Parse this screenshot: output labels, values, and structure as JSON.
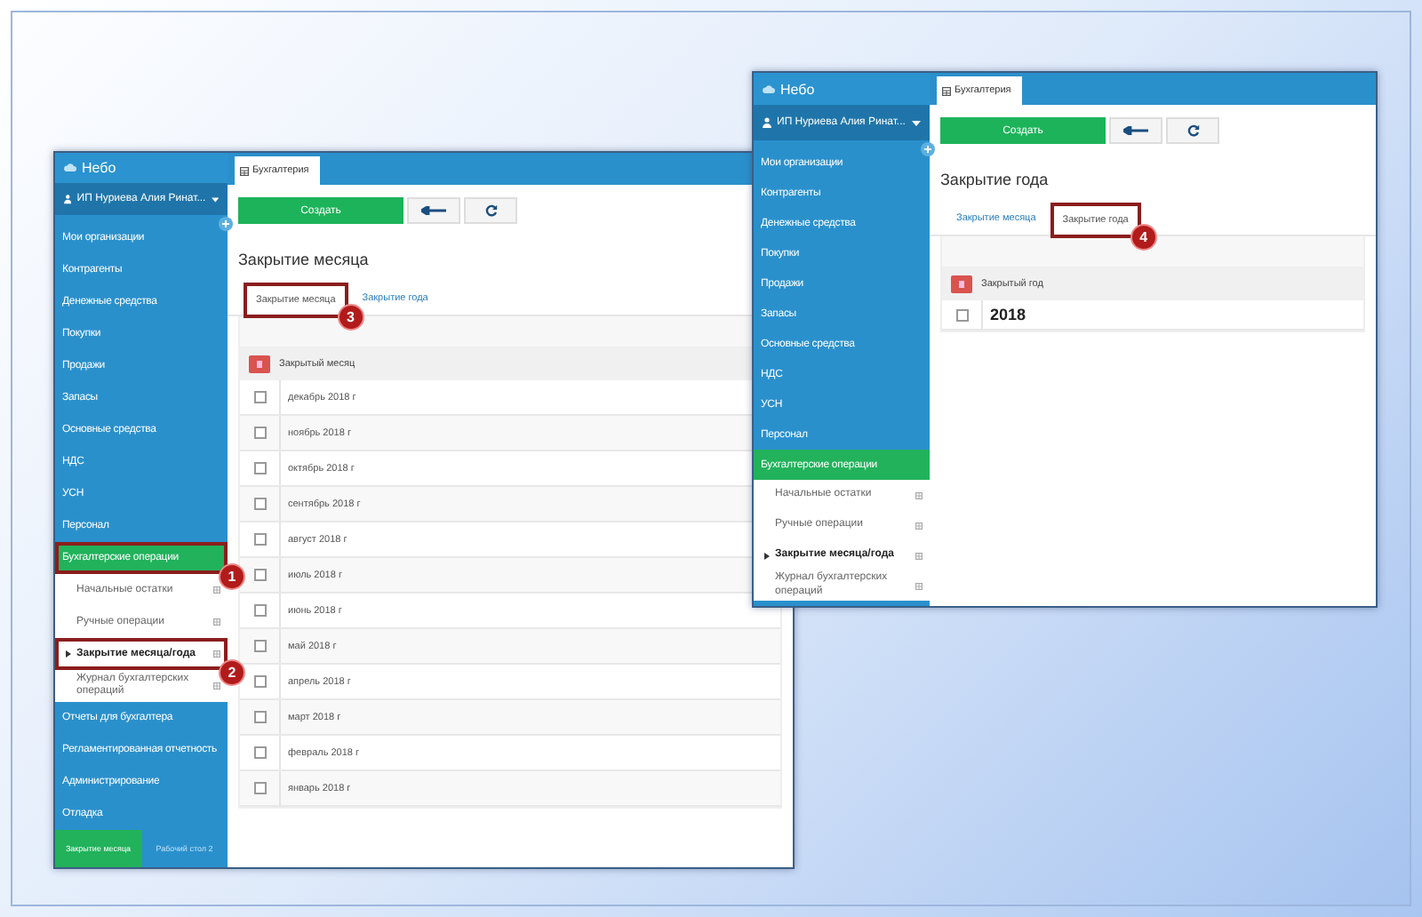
{
  "windows": [
    {
      "logo": "Небо",
      "user": "ИП Нуриева Алия Ринат...",
      "tab": "Бухгалтерия",
      "create_button": "Создать",
      "page_title": "Закрытие месяца",
      "nav": [
        {
          "label": "Мои организации",
          "selected": false
        },
        {
          "label": "Контрагенты",
          "selected": false
        },
        {
          "label": "Денежные средства",
          "selected": false
        },
        {
          "label": "Покупки",
          "selected": false
        },
        {
          "label": "Продажи",
          "selected": false
        },
        {
          "label": "Запасы",
          "selected": false
        },
        {
          "label": "Основные средства",
          "selected": false
        },
        {
          "label": "НДС",
          "selected": false
        },
        {
          "label": "УСН",
          "selected": false
        },
        {
          "label": "Персонал",
          "selected": false
        },
        {
          "label": "Бухгалтерские операции",
          "selected": true,
          "callout": "1",
          "children": [
            {
              "label": "Начальные остатки",
              "selected": false
            },
            {
              "label": "Ручные операции",
              "selected": false
            },
            {
              "label": "Закрытие месяца/года",
              "selected": true,
              "callout": "2"
            },
            {
              "label": "Журнал бухгалтерских операций",
              "selected": false
            }
          ]
        },
        {
          "label": "Отчеты для бухгалтера",
          "selected": false
        },
        {
          "label": "Регламентированная отчетность",
          "selected": false
        },
        {
          "label": "Администрирование",
          "selected": false
        },
        {
          "label": "Отладка",
          "selected": false
        }
      ],
      "bottom_tabs": [
        {
          "label": "Закрытие месяца",
          "selected": true
        },
        {
          "label": "Рабочий стол 2",
          "selected": false
        }
      ],
      "view_tabs": [
        {
          "label": "Закрытие месяца",
          "selected": true,
          "callout": "3"
        },
        {
          "label": "Закрытие года",
          "selected": false
        }
      ],
      "table": {
        "kind": "month",
        "column": "Закрытый месяц",
        "rows": [
          {
            "text": "декабрь 2018 г",
            "checked": false
          },
          {
            "text": "ноябрь 2018 г",
            "checked": false
          },
          {
            "text": "октябрь 2018 г",
            "checked": false
          },
          {
            "text": "сентябрь 2018 г",
            "checked": false
          },
          {
            "text": "август 2018 г",
            "checked": false
          },
          {
            "text": "июль 2018 г",
            "checked": false
          },
          {
            "text": "июнь 2018 г",
            "checked": false
          },
          {
            "text": "май 2018 г",
            "checked": false
          },
          {
            "text": "апрель 2018 г",
            "checked": false
          },
          {
            "text": "март 2018 г",
            "checked": false
          },
          {
            "text": "февраль 2018 г",
            "checked": false
          },
          {
            "text": "январь 2018 г",
            "checked": false
          }
        ]
      }
    },
    {
      "logo": "Небо",
      "user": "ИП Нуриева Алия Ринат...",
      "tab": "Бухгалтерия",
      "create_button": "Создать",
      "page_title": "Закрытие года",
      "nav": [
        {
          "label": "Мои организации",
          "selected": false
        },
        {
          "label": "Контрагенты",
          "selected": false
        },
        {
          "label": "Денежные средства",
          "selected": false
        },
        {
          "label": "Покупки",
          "selected": false
        },
        {
          "label": "Продажи",
          "selected": false
        },
        {
          "label": "Запасы",
          "selected": false
        },
        {
          "label": "Основные средства",
          "selected": false
        },
        {
          "label": "НДС",
          "selected": false
        },
        {
          "label": "УСН",
          "selected": false
        },
        {
          "label": "Персонал",
          "selected": false
        },
        {
          "label": "Бухгалтерские операции",
          "selected": true,
          "children": [
            {
              "label": "Начальные остатки",
              "selected": false
            },
            {
              "label": "Ручные операции",
              "selected": false
            },
            {
              "label": "Закрытие месяца/года",
              "selected": true
            },
            {
              "label": "Журнал бухгалтерских операций",
              "selected": false
            }
          ]
        }
      ],
      "view_tabs": [
        {
          "label": "Закрытие месяца",
          "selected": false
        },
        {
          "label": "Закрытие года",
          "selected": true,
          "callout": "4"
        }
      ],
      "table": {
        "kind": "year",
        "column": "Закрытый год",
        "rows": [
          {
            "text": "2018",
            "checked": false
          }
        ]
      }
    }
  ]
}
